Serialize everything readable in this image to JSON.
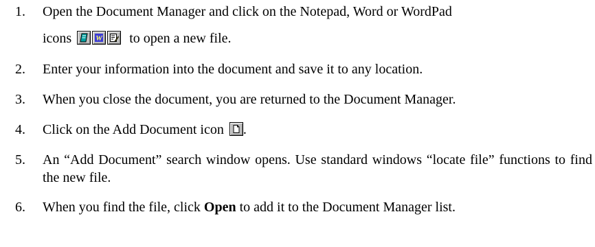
{
  "steps": [
    {
      "number": "1.",
      "text_before_icons": "Open the Document Manager and click on the Notepad, Word or WordPad",
      "icons_prefix": "icons",
      "icons": [
        "notepad-icon",
        "word-icon",
        "wordpad-icon"
      ],
      "text_after_icons": "to open a new file."
    },
    {
      "number": "2.",
      "text": "Enter your information into the document and save it to any location."
    },
    {
      "number": "3.",
      "text": "When you close the document, you are returned to the Document Manager."
    },
    {
      "number": "4.",
      "text_before_icon": "Click on the Add Document icon",
      "icon": "add-document-icon",
      "text_after_icon": "."
    },
    {
      "number": "5.",
      "text": "An “Add Document” search window opens. Use standard windows “locate file” functions to find the new file."
    },
    {
      "number": "6.",
      "text_before_bold": "When you find the file, click",
      "bold": "Open",
      "text_after_bold": "to add it to the Document Manager list."
    }
  ],
  "colors": {
    "text": "#000000",
    "icon_face": "#c0c0c0",
    "word_icon": "#3b3bd6",
    "notepad_icon": "#00a0a0",
    "wordpad_icon": "#e0d000"
  }
}
